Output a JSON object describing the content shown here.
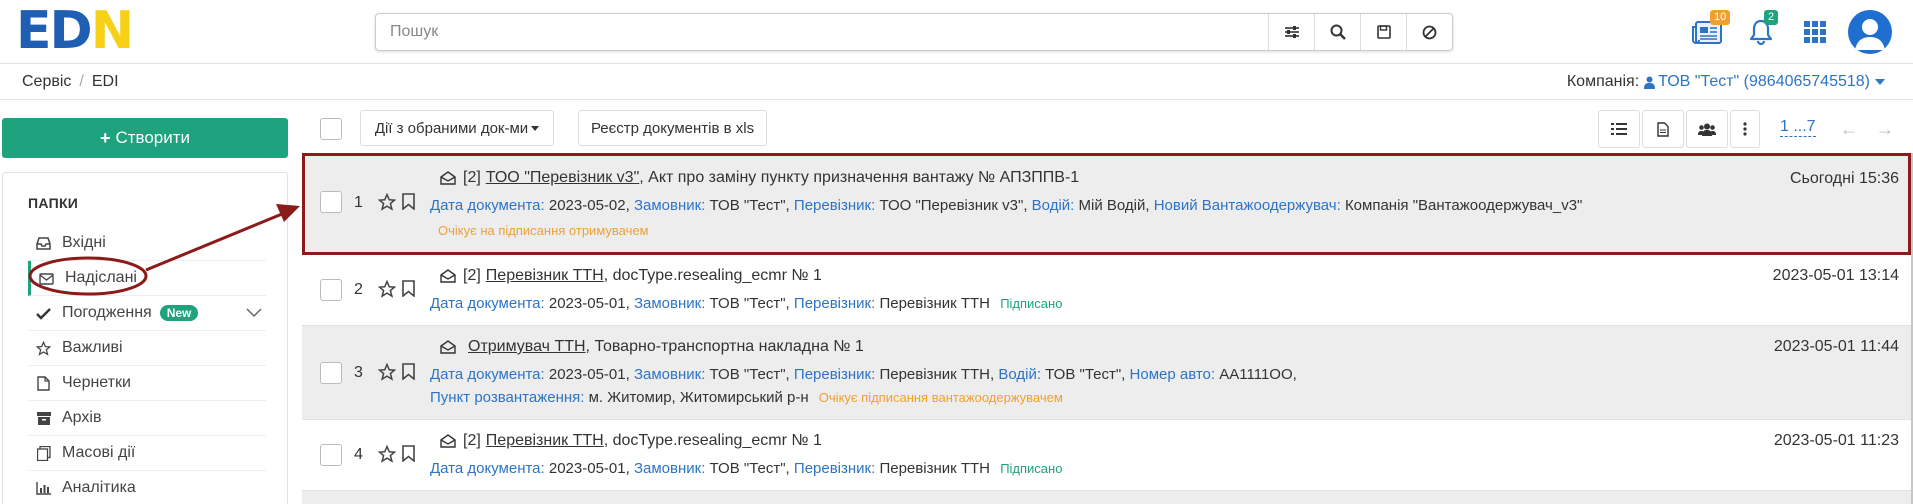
{
  "brand": {
    "logo_text": "EDN",
    "accent": "#1fa27e",
    "link": "#2e74c6",
    "annotation": "#8b1a1a"
  },
  "search": {
    "placeholder": "Пошук",
    "icons": [
      "filter-sliders-icon",
      "search-icon",
      "save-icon",
      "clear-icon"
    ]
  },
  "top": {
    "news_badge": "10",
    "notif_badge": "2",
    "icons": [
      "news-icon",
      "bell-icon",
      "apps-grid-icon",
      "user-avatar"
    ]
  },
  "breadcrumb": {
    "items": [
      "Сервіс",
      "EDI"
    ],
    "separator": "/"
  },
  "company": {
    "label": "Компанія:",
    "value": "ТОВ \"Тест\" (9864065745518)"
  },
  "sidebar": {
    "create_label": "Створити",
    "folders_title": "ПАПКИ",
    "items": [
      {
        "label": "Вхідні",
        "icon": "inbox-icon"
      },
      {
        "label": "Надіслані",
        "icon": "envelope-icon",
        "active": true
      },
      {
        "label": "Погодження",
        "icon": "check-icon",
        "badge": "New"
      },
      {
        "label": "Важливі",
        "icon": "star-icon"
      },
      {
        "label": "Чернетки",
        "icon": "draft-icon"
      },
      {
        "label": "Архів",
        "icon": "archive-icon"
      },
      {
        "label": "Масові дії",
        "icon": "bulk-icon"
      },
      {
        "label": "Аналітика",
        "icon": "chart-icon"
      }
    ]
  },
  "toolbar": {
    "actions_label": "Дії з обраними док-ми",
    "export_label": "Реєстр документів в xls",
    "pager": "1 ...7"
  },
  "documents": [
    {
      "num": "1",
      "count": "[2]",
      "party": "ТОО \"Перевізник v3\"",
      "title": ", Акт про заміну пункту призначення вантажу № АПЗППВ-1",
      "date": "Сьогодні 15:36",
      "l_date": "Дата документа:",
      "v_date": " 2023-05-02,",
      "l_cust": "Замовник:",
      "v_cust": " ТОВ \"Тест\",",
      "l_carrier": "Перевізник:",
      "v_carrier": " ТОО \"Перевізник v3\",",
      "l_driver": "Водій:",
      "v_driver": " Мій Водій,",
      "l_newcons": "Новий Вантажоодержувач:",
      "v_newcons": " Компанія \"Вантажоодержувач_v3\"",
      "status": "Очікує на підписання отримувачем"
    },
    {
      "num": "2",
      "count": "[2]",
      "party": "Перевізник ТТН",
      "title": ", docType.resealing_ecmr № 1",
      "date": "2023-05-01 13:14",
      "l_date": "Дата документа:",
      "v_date": " 2023-05-01,",
      "l_cust": "Замовник:",
      "v_cust": " ТОВ \"Тест\",",
      "l_carrier": "Перевізник:",
      "v_carrier": " Перевізник ТТН",
      "status": "Підписано"
    },
    {
      "num": "3",
      "party": "Отримувач ТТН",
      "title": ", Товарно-транспортна накладна № 1",
      "date": "2023-05-01 11:44",
      "l_date": "Дата документа:",
      "v_date": " 2023-05-01,",
      "l_cust": "Замовник:",
      "v_cust": " ТОВ \"Тест\",",
      "l_carrier": "Перевізник:",
      "v_carrier": " Перевізник ТТН,",
      "l_driver": "Водій:",
      "v_driver": " ТОВ \"Тест\",",
      "l_plate": "Номер авто:",
      "v_plate": " АА1111ОО,",
      "l_unload": "Пункт розвантаження:",
      "v_unload": " м. Житомир, Житомирський р-н",
      "status": "Очікує підписання вантажоодержувачем"
    },
    {
      "num": "4",
      "count": "[2]",
      "party": "Перевізник ТТН",
      "title": ", docType.resealing_ecmr № 1",
      "date": "2023-05-01 11:23",
      "l_date": "Дата документа:",
      "v_date": " 2023-05-01,",
      "l_cust": "Замовник:",
      "v_cust": " ТОВ \"Тест\",",
      "l_carrier": "Перевізник:",
      "v_carrier": " Перевізник ТТН",
      "status": "Підписано"
    }
  ]
}
